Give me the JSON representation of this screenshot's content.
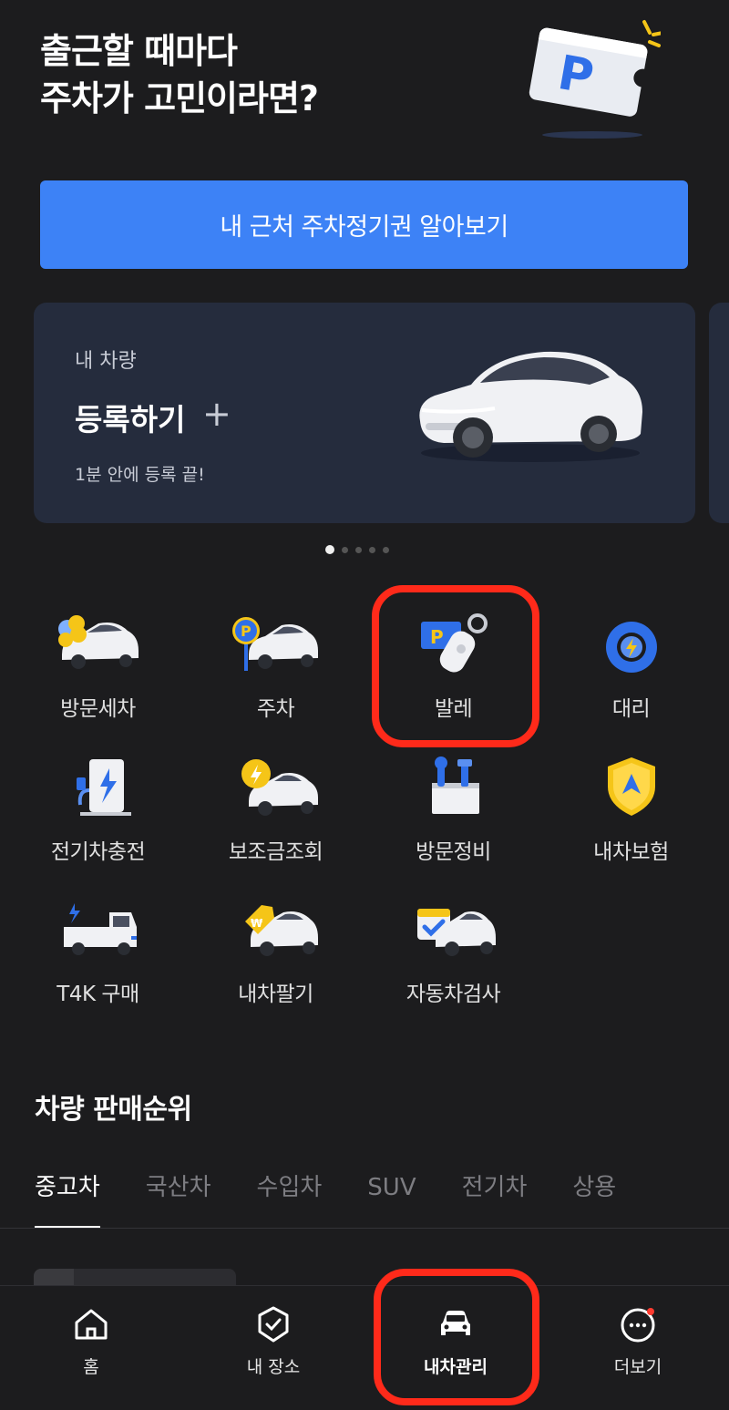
{
  "hero": {
    "title_line1": "출근할 때마다",
    "title_line2": "주차가 고민이라면?"
  },
  "cta": {
    "label": "내 근처 주차정기권 알아보기"
  },
  "vehicle_card": {
    "label": "내 차량",
    "title": "등록하기",
    "plus": "+",
    "subtitle": "1분 안에 등록 끝!"
  },
  "carousel": {
    "page_count": 5,
    "active_index": 0
  },
  "services": [
    {
      "label": "방문세차",
      "icon": "car-wash-icon"
    },
    {
      "label": "주차",
      "icon": "parking-car-icon"
    },
    {
      "label": "발레",
      "icon": "valet-key-icon"
    },
    {
      "label": "대리",
      "icon": "steering-wheel-icon"
    },
    {
      "label": "전기차충전",
      "icon": "ev-charger-icon"
    },
    {
      "label": "보조금조회",
      "icon": "subsidy-coin-icon"
    },
    {
      "label": "방문정비",
      "icon": "toolbox-icon"
    },
    {
      "label": "내차보험",
      "icon": "shield-icon"
    },
    {
      "label": "T4K 구매",
      "icon": "truck-icon"
    },
    {
      "label": "내차팔기",
      "icon": "price-tag-car-icon"
    },
    {
      "label": "자동차검사",
      "icon": "calendar-check-car-icon"
    }
  ],
  "ranking": {
    "title": "차량 판매순위",
    "tabs": [
      "중고차",
      "국산차",
      "수입차",
      "SUV",
      "전기차",
      "상용"
    ],
    "active_tab": 0
  },
  "bottom_nav": [
    {
      "label": "홈",
      "icon": "home-icon"
    },
    {
      "label": "내 장소",
      "icon": "place-check-icon"
    },
    {
      "label": "내차관리",
      "icon": "car-front-icon"
    },
    {
      "label": "더보기",
      "icon": "more-dots-icon"
    }
  ],
  "colors": {
    "background": "#1c1c1e",
    "accent": "#3d82f6",
    "card": "#252c3d",
    "highlight": "#ff2a1a",
    "notification": "#ff3b30"
  }
}
